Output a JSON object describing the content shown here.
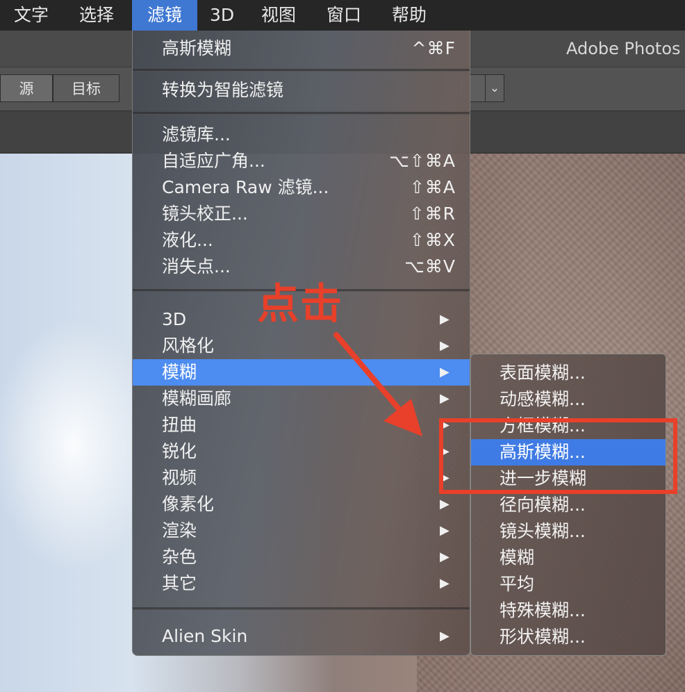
{
  "menubar": {
    "items": [
      {
        "label": "文字"
      },
      {
        "label": "选择"
      },
      {
        "label": "滤镜",
        "active": true
      },
      {
        "label": "3D"
      },
      {
        "label": "视图"
      },
      {
        "label": "窗口"
      },
      {
        "label": "帮助"
      }
    ]
  },
  "app": {
    "title": "Adobe Photos"
  },
  "options": {
    "source_label": "源",
    "target_label": "目标",
    "dropdown_icon": "chevron-down-icon"
  },
  "filter_menu": {
    "last_filter": {
      "label": "高斯模糊",
      "shortcut": "^⌘F"
    },
    "convert_smart": {
      "label": "转换为智能滤镜"
    },
    "filter_gallery": {
      "label": "滤镜库..."
    },
    "adaptive_wide": {
      "label": "自适应广角...",
      "shortcut": "⌥⇧⌘A"
    },
    "camera_raw": {
      "label": "Camera Raw 滤镜...",
      "shortcut": "⇧⌘A"
    },
    "lens_correction": {
      "label": "镜头校正...",
      "shortcut": "⇧⌘R"
    },
    "liquify": {
      "label": "液化...",
      "shortcut": "⇧⌘X"
    },
    "vanishing_point": {
      "label": "消失点...",
      "shortcut": "⌥⌘V"
    },
    "submenus": [
      {
        "label": "3D"
      },
      {
        "label": "风格化"
      },
      {
        "label": "模糊",
        "highlighted": true
      },
      {
        "label": "模糊画廊"
      },
      {
        "label": "扭曲"
      },
      {
        "label": "锐化"
      },
      {
        "label": "视频"
      },
      {
        "label": "像素化"
      },
      {
        "label": "渲染"
      },
      {
        "label": "杂色"
      },
      {
        "label": "其它"
      }
    ],
    "alien_skin": {
      "label": "Alien Skin"
    },
    "arrow_glyph": "▶"
  },
  "blur_submenu": {
    "items": [
      {
        "label": "表面模糊..."
      },
      {
        "label": "动感模糊..."
      },
      {
        "label": "方框模糊..."
      },
      {
        "label": "高斯模糊...",
        "highlighted": true
      },
      {
        "label": "进一步模糊"
      },
      {
        "label": "径向模糊..."
      },
      {
        "label": "镜头模糊..."
      },
      {
        "label": "模糊"
      },
      {
        "label": "平均"
      },
      {
        "label": "特殊模糊..."
      },
      {
        "label": "形状模糊..."
      }
    ]
  },
  "annotation": {
    "text": "点击",
    "color": "#e8402a"
  },
  "colors": {
    "highlight": "#4d8cf0",
    "submenu_highlight": "#3f7be4",
    "menubar_active": "#3f78d2"
  }
}
